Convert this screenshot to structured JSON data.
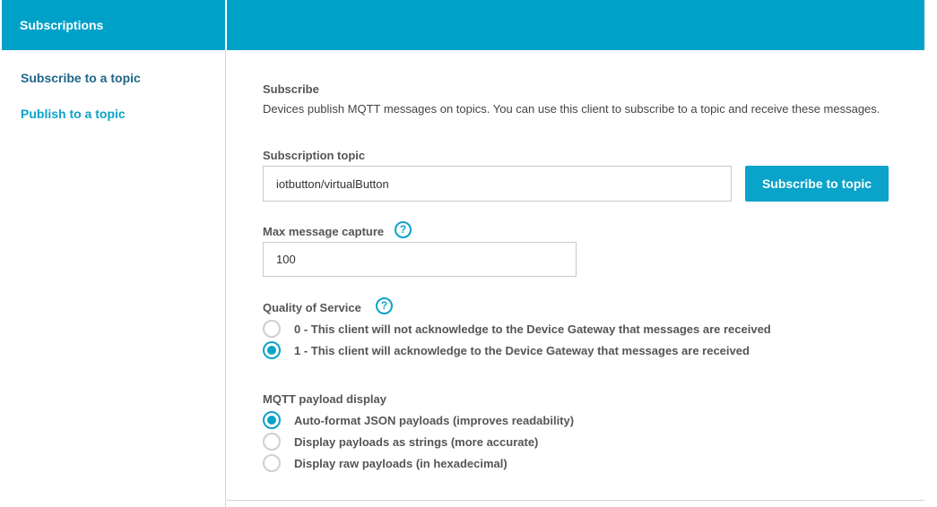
{
  "header": {
    "title": "Subscriptions"
  },
  "sidebar": {
    "items": [
      {
        "label": "Subscribe to a topic"
      },
      {
        "label": "Publish to a topic"
      }
    ]
  },
  "subscribe": {
    "heading": "Subscribe",
    "description": "Devices publish MQTT messages on topics. You can use this client to subscribe to a topic and receive these messages.",
    "topic_label": "Subscription topic",
    "topic_value": "iotbutton/virtualButton",
    "subscribe_button": "Subscribe to topic",
    "max_capture_label": "Max message capture",
    "max_capture_value": "100",
    "help_glyph": "?"
  },
  "qos": {
    "label": "Quality of Service",
    "options": [
      {
        "label": "0 - This client will not acknowledge to the Device Gateway that messages are received",
        "selected": false
      },
      {
        "label": "1 - This client will acknowledge to the Device Gateway that messages are received",
        "selected": true
      }
    ]
  },
  "payload": {
    "label": "MQTT payload display",
    "options": [
      {
        "label": "Auto-format JSON payloads (improves readability)",
        "selected": true
      },
      {
        "label": "Display payloads as strings (more accurate)",
        "selected": false
      },
      {
        "label": "Display raw payloads (in hexadecimal)",
        "selected": false
      }
    ]
  },
  "colors": {
    "accent": "#00a1c9",
    "nav_active": "#1f6688"
  },
  "icons": {
    "help": "help-circle-icon",
    "radio": "radio-icon"
  }
}
